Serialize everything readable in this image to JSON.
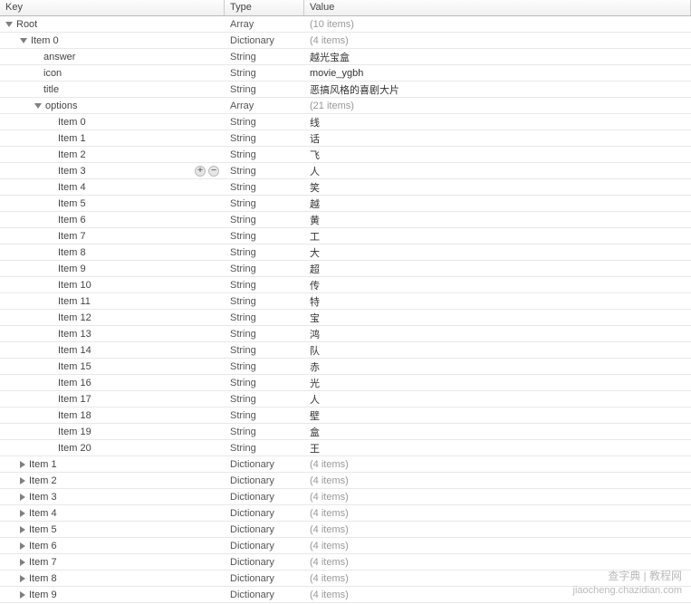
{
  "header": {
    "key": "Key",
    "type": "Type",
    "value": "Value"
  },
  "rows": [
    {
      "indent": 0,
      "disclosure": "open",
      "key": "Root",
      "type": "Array",
      "value": "(10 items)",
      "muted": true
    },
    {
      "indent": 1,
      "disclosure": "open",
      "key": "Item 0",
      "type": "Dictionary",
      "value": "(4 items)",
      "muted": true
    },
    {
      "indent": 2,
      "disclosure": "none",
      "key": "answer",
      "type": "String",
      "value": "越光宝盒"
    },
    {
      "indent": 2,
      "disclosure": "none",
      "key": "icon",
      "type": "String",
      "value": "movie_ygbh"
    },
    {
      "indent": 2,
      "disclosure": "none",
      "key": "title",
      "type": "String",
      "value": "恶搞风格的喜剧大片"
    },
    {
      "indent": 2,
      "disclosure": "open",
      "key": "options",
      "type": "Array",
      "value": "(21 items)",
      "muted": true
    },
    {
      "indent": 3,
      "disclosure": "none",
      "key": "Item 0",
      "type": "String",
      "value": "线"
    },
    {
      "indent": 3,
      "disclosure": "none",
      "key": "Item 1",
      "type": "String",
      "value": "话"
    },
    {
      "indent": 3,
      "disclosure": "none",
      "key": "Item 2",
      "type": "String",
      "value": "飞"
    },
    {
      "indent": 3,
      "disclosure": "none",
      "key": "Item 3",
      "type": "String",
      "value": "人",
      "actions": true
    },
    {
      "indent": 3,
      "disclosure": "none",
      "key": "Item 4",
      "type": "String",
      "value": "笑"
    },
    {
      "indent": 3,
      "disclosure": "none",
      "key": "Item 5",
      "type": "String",
      "value": "越"
    },
    {
      "indent": 3,
      "disclosure": "none",
      "key": "Item 6",
      "type": "String",
      "value": "黄"
    },
    {
      "indent": 3,
      "disclosure": "none",
      "key": "Item 7",
      "type": "String",
      "value": "工"
    },
    {
      "indent": 3,
      "disclosure": "none",
      "key": "Item 8",
      "type": "String",
      "value": "大"
    },
    {
      "indent": 3,
      "disclosure": "none",
      "key": "Item 9",
      "type": "String",
      "value": "超"
    },
    {
      "indent": 3,
      "disclosure": "none",
      "key": "Item 10",
      "type": "String",
      "value": "传"
    },
    {
      "indent": 3,
      "disclosure": "none",
      "key": "Item 11",
      "type": "String",
      "value": "特"
    },
    {
      "indent": 3,
      "disclosure": "none",
      "key": "Item 12",
      "type": "String",
      "value": "宝"
    },
    {
      "indent": 3,
      "disclosure": "none",
      "key": "Item 13",
      "type": "String",
      "value": "鸿"
    },
    {
      "indent": 3,
      "disclosure": "none",
      "key": "Item 14",
      "type": "String",
      "value": "队"
    },
    {
      "indent": 3,
      "disclosure": "none",
      "key": "Item 15",
      "type": "String",
      "value": "赤"
    },
    {
      "indent": 3,
      "disclosure": "none",
      "key": "Item 16",
      "type": "String",
      "value": "光"
    },
    {
      "indent": 3,
      "disclosure": "none",
      "key": "Item 17",
      "type": "String",
      "value": "人"
    },
    {
      "indent": 3,
      "disclosure": "none",
      "key": "Item 18",
      "type": "String",
      "value": "壁"
    },
    {
      "indent": 3,
      "disclosure": "none",
      "key": "Item 19",
      "type": "String",
      "value": "盒"
    },
    {
      "indent": 3,
      "disclosure": "none",
      "key": "Item 20",
      "type": "String",
      "value": "王"
    },
    {
      "indent": 1,
      "disclosure": "closed",
      "key": "Item 1",
      "type": "Dictionary",
      "value": "(4 items)",
      "muted": true
    },
    {
      "indent": 1,
      "disclosure": "closed",
      "key": "Item 2",
      "type": "Dictionary",
      "value": "(4 items)",
      "muted": true
    },
    {
      "indent": 1,
      "disclosure": "closed",
      "key": "Item 3",
      "type": "Dictionary",
      "value": "(4 items)",
      "muted": true
    },
    {
      "indent": 1,
      "disclosure": "closed",
      "key": "Item 4",
      "type": "Dictionary",
      "value": "(4 items)",
      "muted": true
    },
    {
      "indent": 1,
      "disclosure": "closed",
      "key": "Item 5",
      "type": "Dictionary",
      "value": "(4 items)",
      "muted": true
    },
    {
      "indent": 1,
      "disclosure": "closed",
      "key": "Item 6",
      "type": "Dictionary",
      "value": "(4 items)",
      "muted": true
    },
    {
      "indent": 1,
      "disclosure": "closed",
      "key": "Item 7",
      "type": "Dictionary",
      "value": "(4 items)",
      "muted": true
    },
    {
      "indent": 1,
      "disclosure": "closed",
      "key": "Item 8",
      "type": "Dictionary",
      "value": "(4 items)",
      "muted": true
    },
    {
      "indent": 1,
      "disclosure": "closed",
      "key": "Item 9",
      "type": "Dictionary",
      "value": "(4 items)",
      "muted": true
    }
  ],
  "watermark": {
    "line1": "查字典 | 教程网",
    "line2": "jiaocheng.chazidian.com"
  }
}
